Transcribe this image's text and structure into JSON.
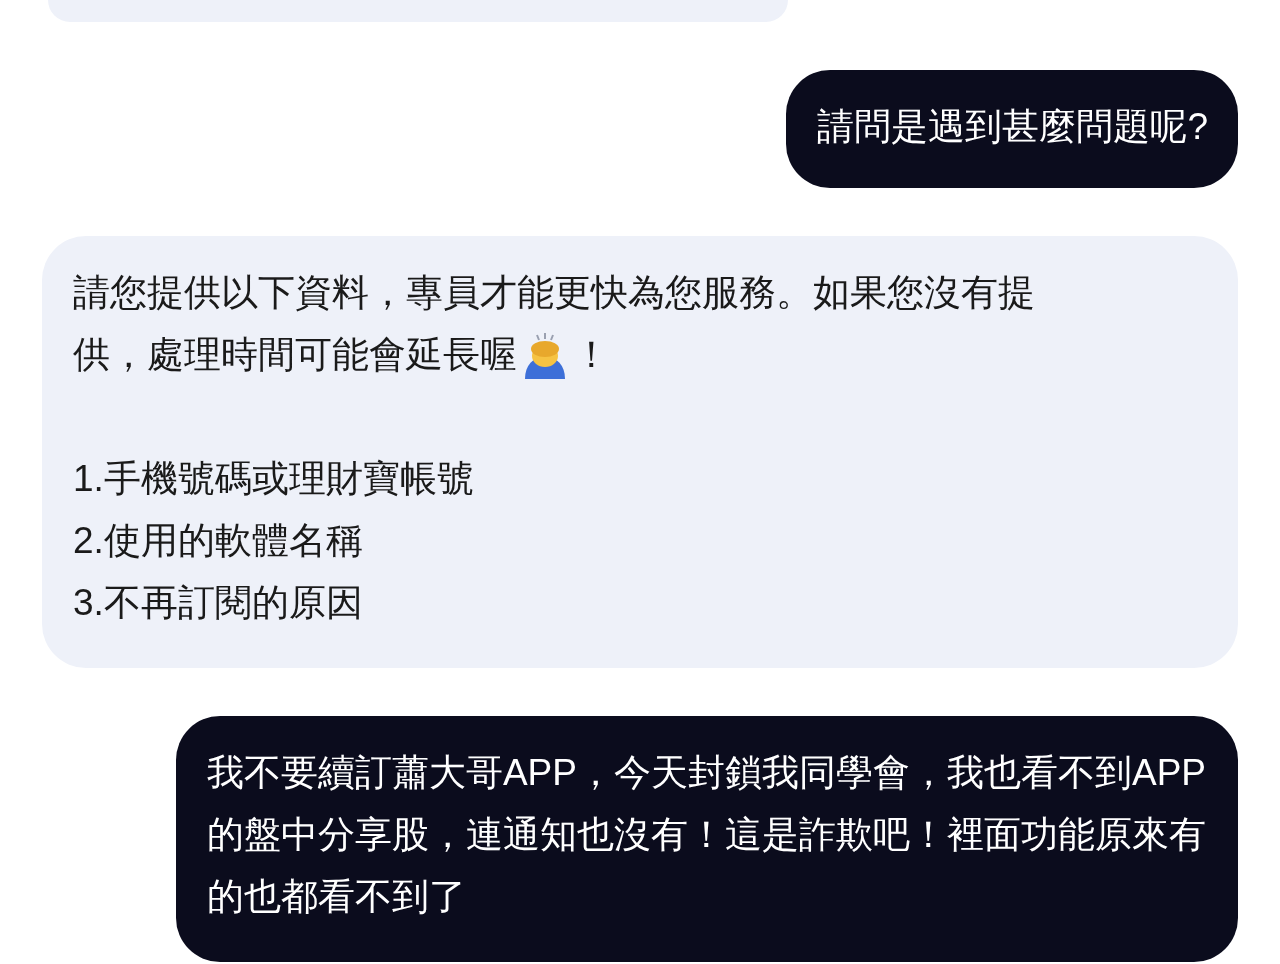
{
  "messages": [
    {
      "kind": "fragment"
    },
    {
      "kind": "sent",
      "blocks": [
        {
          "kind": "line",
          "text": "請問是遇到甚麼問題呢?"
        }
      ]
    },
    {
      "kind": "received",
      "blocks": [
        {
          "kind": "line",
          "text": "請您提供以下資料，專員才能更快為您服務。如果您沒有提"
        },
        {
          "kind": "rich",
          "parts": [
            {
              "kind": "text",
              "text": "供，處理時間可能會延長喔"
            },
            {
              "kind": "emoji"
            },
            {
              "kind": "text",
              "text": "！"
            }
          ]
        },
        {
          "kind": "gap"
        },
        {
          "kind": "line",
          "text": "1.手機號碼或理財寶帳號"
        },
        {
          "kind": "line",
          "text": "2.使用的軟體名稱"
        },
        {
          "kind": "line",
          "text": "3.不再訂閱的原因"
        }
      ]
    },
    {
      "kind": "sent",
      "blocks": [
        {
          "kind": "line",
          "text": "我不要續訂蕭大哥APP，今天封鎖我同學會，我也看不到APP"
        },
        {
          "kind": "line",
          "text": "的盤中分享股，連通知也沒有！這是詐欺吧！裡面功能原來有"
        },
        {
          "kind": "line",
          "text": "的也都看不到了"
        }
      ]
    }
  ]
}
